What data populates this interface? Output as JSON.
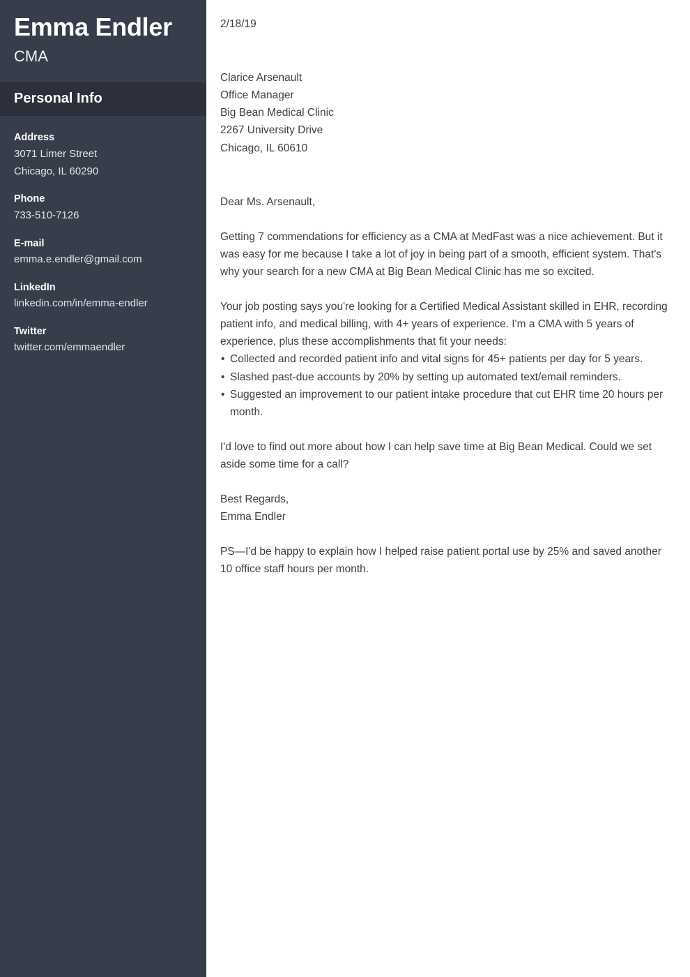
{
  "colors": {
    "sidebar_bg": "#373d4a",
    "sidebar_band_bg": "#2b303b",
    "sidebar_text": "#ffffff",
    "sidebar_value_text": "#e2e4e8",
    "letter_bg": "#ffffff",
    "letter_text": "#3c4048"
  },
  "sidebar": {
    "full_name": "Emma Endler",
    "job_title": "CMA",
    "section_title": "Personal Info",
    "contacts": [
      {
        "label": "Address",
        "lines": [
          "3071 Limer Street",
          "Chicago, IL 60290"
        ]
      },
      {
        "label": "Phone",
        "lines": [
          "733-510-7126"
        ]
      },
      {
        "label": "E-mail",
        "lines": [
          "emma.e.endler@gmail.com"
        ]
      },
      {
        "label": "LinkedIn",
        "lines": [
          "linkedin.com/in/emma-endler"
        ]
      },
      {
        "label": "Twitter",
        "lines": [
          "twitter.com/emmaendler"
        ]
      }
    ]
  },
  "letter": {
    "date": "2/18/19",
    "recipient": {
      "name": "Clarice Arsenault",
      "title": "Office Manager",
      "company": "Big Bean Medical Clinic",
      "street": "2267 University Drive",
      "city_state_zip": "Chicago, IL 60610"
    },
    "salutation": "Dear Ms. Arsenault,",
    "paragraph_1": "Getting 7 commendations for efficiency as a CMA at MedFast was a nice achievement. But it was easy for me because I take a lot of joy in being part of a smooth, efficient system. That's why your search for a new CMA at Big Bean Medical Clinic has me so excited.",
    "paragraph_2": "Your job posting says you're looking for a Certified Medical Assistant skilled in EHR, recording patient info, and medical billing, with 4+ years of experience. I'm a CMA with 5 years of experience, plus these accomplishments that fit your needs:",
    "bullets": [
      "Collected and recorded patient info and vital signs for 45+ patients per day for 5 years.",
      "Slashed past-due accounts by 20% by setting up automated text/email reminders.",
      "Suggested an improvement to our patient intake procedure that cut EHR time 20 hours per month."
    ],
    "bullet_glyph": "•",
    "paragraph_3": "I'd love to find out more about how I can help save time at Big Bean Medical. Could we set aside some time for a call?",
    "signoff": "Best Regards,",
    "signature_name": "Emma Endler",
    "postscript": "PS—I'd be happy to explain how I helped raise patient portal use by 25% and saved another 10 office staff hours per month."
  }
}
